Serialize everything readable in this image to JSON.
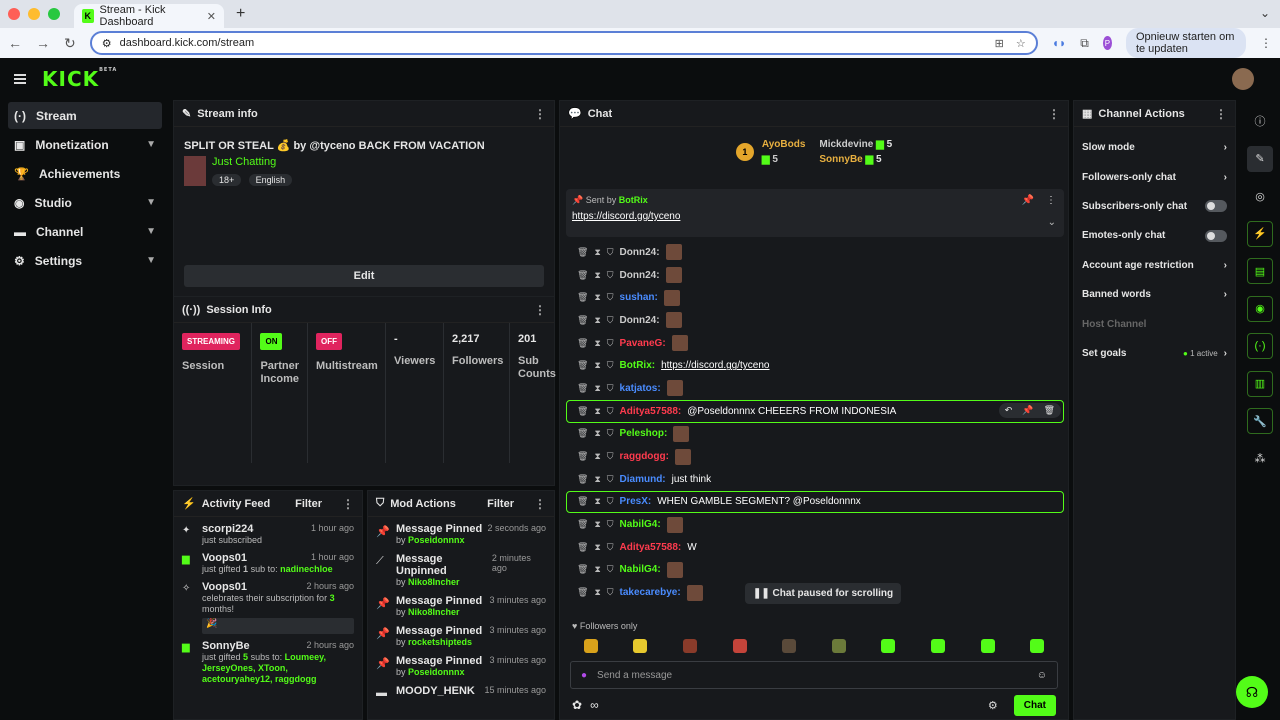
{
  "browser": {
    "tab_title": "Stream - Kick Dashboard",
    "url": "dashboard.kick.com/stream",
    "update_button": "Opnieuw starten om te updaten",
    "profile_letter": "P"
  },
  "app": {
    "logo": "KICK",
    "logo_sup": "BETA"
  },
  "sidebar": {
    "items": [
      {
        "label": "Stream",
        "icon": "broadcast-icon"
      },
      {
        "label": "Monetization",
        "icon": "money-icon"
      },
      {
        "label": "Achievements",
        "icon": "trophy-icon"
      },
      {
        "label": "Studio",
        "icon": "studio-icon"
      },
      {
        "label": "Channel",
        "icon": "channel-icon"
      },
      {
        "label": "Settings",
        "icon": "gear-icon"
      }
    ]
  },
  "stream_info": {
    "header": "Stream info",
    "title": "SPLIT OR STEAL 💰 by @tyceno BACK FROM VACATION",
    "category": "Just Chatting",
    "tags": [
      "18+",
      "English"
    ],
    "edit_label": "Edit"
  },
  "session_info": {
    "header": "Session Info",
    "streaming_badge": "STREAMING",
    "session_label": "Session",
    "partner_badge": "ON",
    "partner_label": "Partner Income",
    "multistream_badge": "OFF",
    "multistream_label": "Multistream",
    "viewers_value": "-",
    "viewers_label": "Viewers",
    "followers_value": "2,217",
    "followers_label": "Followers",
    "subs_value": "201",
    "subs_label": "Sub Counts"
  },
  "activity": {
    "header": "Activity Feed",
    "filter": "Filter",
    "items": [
      {
        "name": "scorpi224",
        "time": "1 hour ago",
        "sub": "just subscribed"
      },
      {
        "name": "Voops01",
        "time": "1 hour ago",
        "sub_pre": "just gifted",
        "sub_num": "1",
        "sub_mid": "sub to:",
        "sub_who": "nadinechloe"
      },
      {
        "name": "Voops01",
        "time": "2 hours ago",
        "sub_pre": "celebrates their subscription for",
        "sub_num": "3",
        "sub_post": "months!",
        "emote": "🎉"
      },
      {
        "name": "SonnyBe",
        "time": "2 hours ago",
        "sub_pre": "just gifted",
        "sub_num": "5",
        "sub_mid": "subs to:",
        "sub_who": "Loumeey, JerseyOnes, XToon, acetouryahey12, raggdogg"
      }
    ]
  },
  "mod": {
    "header": "Mod Actions",
    "filter": "Filter",
    "items": [
      {
        "action": "Message Pinned",
        "time": "2 seconds ago",
        "by": "by",
        "who": "Poseidonnnx"
      },
      {
        "action": "Message Unpinned",
        "time": "2 minutes ago",
        "by": "by",
        "who": "Niko8Incher"
      },
      {
        "action": "Message Pinned",
        "time": "3 minutes ago",
        "by": "by",
        "who": "Niko8Incher"
      },
      {
        "action": "Message Pinned",
        "time": "3 minutes ago",
        "by": "by",
        "who": "rocketshipteds"
      },
      {
        "action": "Message Pinned",
        "time": "3 minutes ago",
        "by": "by",
        "who": "Poseidonnnx"
      },
      {
        "action": "MOODY_HENK",
        "time": "15 minutes ago",
        "by": "",
        "who": ""
      }
    ]
  },
  "chat": {
    "header": "Chat",
    "leaders": {
      "first": {
        "name": "AyoBods",
        "count": "5",
        "rank": "1"
      },
      "second": {
        "name": "Mickdevine",
        "count": "5"
      },
      "third": {
        "name": "SonnyBe",
        "count": "5"
      }
    },
    "pinned": {
      "sent_by": "Sent by",
      "user": "BotRix",
      "link": "https://discord.gg/tyceno"
    },
    "messages": [
      {
        "user": "Donn24:",
        "color": "#cccccc",
        "text": "",
        "emote": true
      },
      {
        "user": "Donn24:",
        "color": "#cccccc",
        "text": "",
        "emote": true
      },
      {
        "user": "sushan:",
        "color": "#4a8cff",
        "text": "",
        "emote": true
      },
      {
        "user": "Donn24:",
        "color": "#cccccc",
        "text": "",
        "emote": true
      },
      {
        "user": "PavaneG:",
        "color": "#ff3b4e",
        "text": "",
        "emote": true
      },
      {
        "user": "BotRix:",
        "color": "#53fc18",
        "text": "https://discord.gg/tyceno",
        "link": true
      },
      {
        "user": "katjatos:",
        "color": "#4a8cff",
        "text": "",
        "emote": true
      },
      {
        "user": "Aditya57588:",
        "color": "#ff3b4e",
        "text": "@Poseldonnnx CHEEERS FROM INDONESIA",
        "hl": true
      },
      {
        "user": "Peleshop:",
        "color": "#53fc18",
        "text": "",
        "emote": true
      },
      {
        "user": "raggdogg:",
        "color": "#ff3b4e",
        "text": "",
        "emote": true
      },
      {
        "user": "Diamund:",
        "color": "#4a8cff",
        "text": "just think"
      },
      {
        "user": "PresX:",
        "color": "#4a8cff",
        "text": "WHEN GAMBLE SEGMENT? @Poseldonnnx",
        "hl": true
      },
      {
        "user": "NabilG4:",
        "color": "#53fc18",
        "text": "",
        "emote": true
      },
      {
        "user": "Aditya57588:",
        "color": "#ff3b4e",
        "text": "W"
      },
      {
        "user": "NabilG4:",
        "color": "#53fc18",
        "text": "",
        "emote": true
      },
      {
        "user": "takecarebye:",
        "color": "#4a8cff",
        "text": "",
        "emote": true
      }
    ],
    "paused": "Chat paused for scrolling",
    "followers_only": "Followers only",
    "placeholder": "Send a message",
    "chat_button": "Chat"
  },
  "actions": {
    "header": "Channel Actions",
    "items": [
      {
        "label": "Slow mode",
        "kind": "chevron"
      },
      {
        "label": "Followers-only chat",
        "kind": "chevron"
      },
      {
        "label": "Subscribers-only chat",
        "kind": "toggle"
      },
      {
        "label": "Emotes-only chat",
        "kind": "toggle"
      },
      {
        "label": "Account age restriction",
        "kind": "chevron"
      },
      {
        "label": "Banned words",
        "kind": "chevron"
      },
      {
        "label": "Host Channel",
        "kind": "disabled"
      },
      {
        "label": "Set goals",
        "kind": "chevron",
        "extra": "1 active"
      }
    ]
  },
  "colors": {
    "accent": "#53fc18",
    "red": "#e0245e",
    "bg": "#0b0d0e",
    "panel": "#17191c"
  }
}
